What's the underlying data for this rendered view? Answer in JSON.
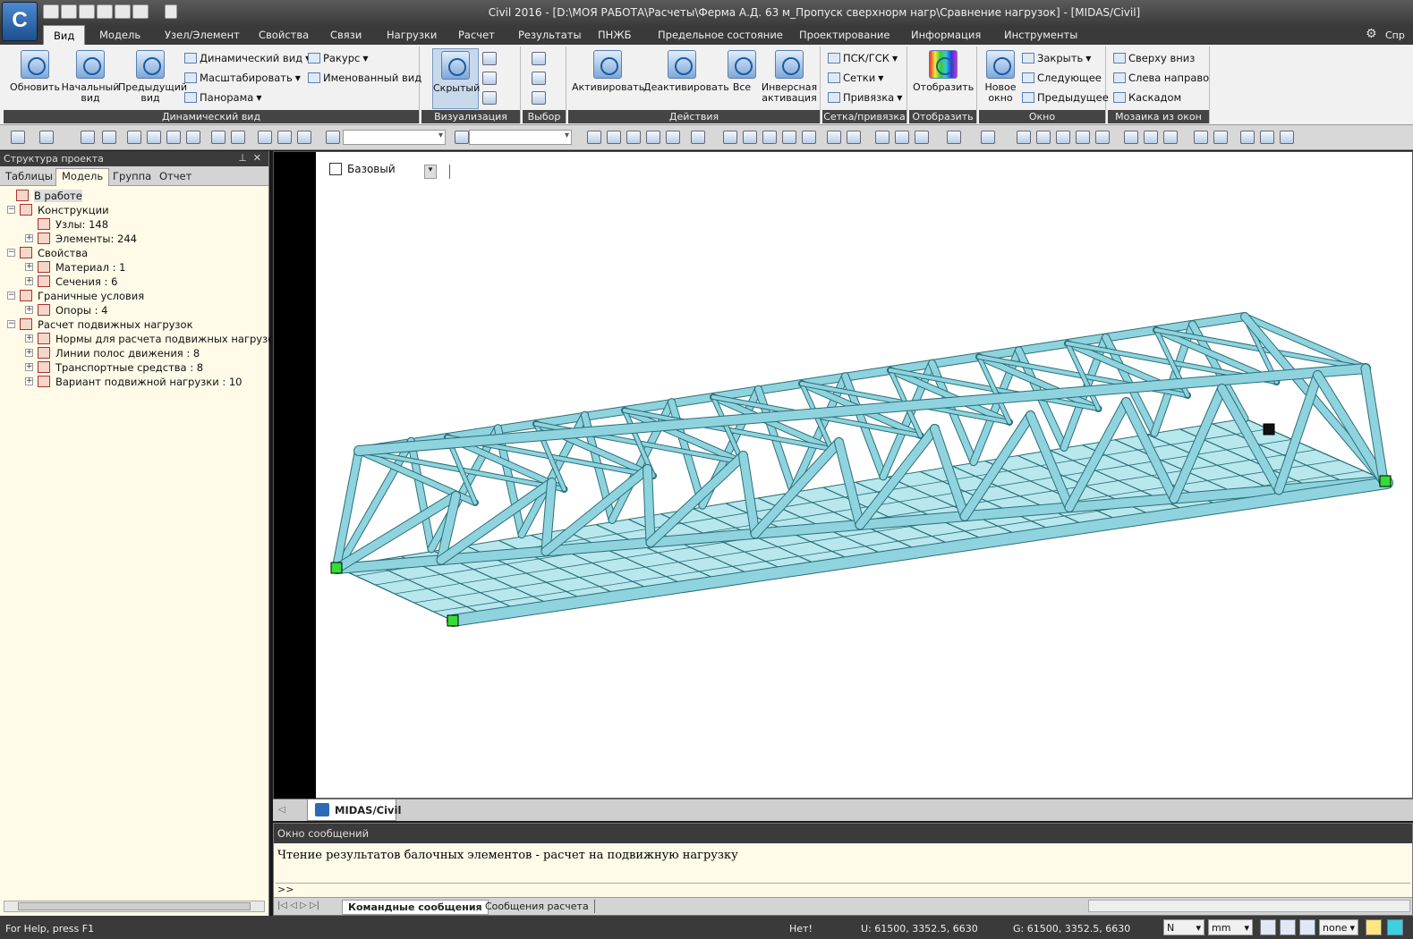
{
  "window": {
    "title": "Civil 2016 - [D:\\МОЯ РАБОТА\\Расчеты\\Ферма А.Д. 63 м_Пропуск сверхнорм нагр\\Сравнение нагрузок] - [MIDAS/Civil]",
    "app_logo": "C"
  },
  "menu": {
    "tabs": [
      "Вид",
      "Модель",
      "Узел/Элемент",
      "Свойства",
      "Связи",
      "Нагрузки",
      "Расчет",
      "Результаты",
      "ПНЖБ",
      "Предельное состояние",
      "Проектирование",
      "Информация",
      "Инструменты"
    ],
    "help": "Спр"
  },
  "ribbon": {
    "dynamic": {
      "caption": "Динамический вид",
      "refresh": "Обновить",
      "initial_1": "Начальный",
      "initial_2": "вид",
      "prev_1": "Предыдущий",
      "prev_2": "вид",
      "dyn": "Динамический вид",
      "scale": "Масштабировать",
      "pan": "Панорама",
      "angle": "Ракурс",
      "named": "Именованный вид"
    },
    "viz": {
      "caption": "Визуализация вида",
      "hidden": "Скрытый"
    },
    "select": {
      "caption": "Выбор"
    },
    "actions": {
      "caption": "Действия",
      "activate": "Активировать",
      "deactivate": "Деактивировать",
      "all": "Все",
      "inverse_1": "Инверсная",
      "inverse_2": "активация"
    },
    "grid": {
      "caption": "Сетка/привязка",
      "ucs": "ПСК/ГСК",
      "grids": "Сетки",
      "snap": "Привязка"
    },
    "display": {
      "caption": "Отобразить",
      "display": "Отобразить"
    },
    "window": {
      "caption": "Окно",
      "new_1": "Новое",
      "new_2": "окно",
      "close": "Закрыть",
      "next": "Следующее",
      "prev": "Предыдущее"
    },
    "mosaic": {
      "caption": "Мозаика из окон",
      "top_down": "Сверху вниз",
      "left_right": "Слева направо",
      "cascade": "Каскадом"
    }
  },
  "tree_panel": {
    "title": "Структура проекта",
    "tabs": [
      "Таблицы",
      "Модель",
      "Группа",
      "Отчет"
    ],
    "items": [
      {
        "label": "В работе",
        "indent": 0
      },
      {
        "label": "Конструкции",
        "indent": 1
      },
      {
        "label": "Узлы: 148",
        "indent": 2
      },
      {
        "label": "Элементы: 244",
        "indent": 2
      },
      {
        "label": "Свойства",
        "indent": 1
      },
      {
        "label": "Материал : 1",
        "indent": 2
      },
      {
        "label": "Сечения : 6",
        "indent": 2
      },
      {
        "label": "Граничные условия",
        "indent": 1
      },
      {
        "label": "Опоры : 4",
        "indent": 2
      },
      {
        "label": "Расчет подвижных нагрузок",
        "indent": 1
      },
      {
        "label": "Нормы для расчета подвижных нагрузок [ Ru",
        "indent": 2
      },
      {
        "label": "Линии полос движения : 8",
        "indent": 2
      },
      {
        "label": "Транспортные средства : 8",
        "indent": 2
      },
      {
        "label": "Вариант подвижной нагрузки : 10",
        "indent": 2
      }
    ]
  },
  "viewport": {
    "view_name": "Базовый",
    "tab": "MIDAS/Civil",
    "model_color": "#8fd3de",
    "line_color": "#2a6f78"
  },
  "messages": {
    "title": "Окно сообщений",
    "text": "Чтение результатов балочных элементов - расчет на подвижную нагрузку",
    "prompt": ">>",
    "tabs": [
      "Командные сообщения",
      "Сообщения расчета"
    ]
  },
  "status": {
    "help": "For Help, press F1",
    "net": "Нет!",
    "ucs": "U: 61500, 3352.5, 6630",
    "gcs": "G: 61500, 3352.5, 6630",
    "force_unit": "N",
    "length_unit": "mm",
    "extra": "none"
  }
}
